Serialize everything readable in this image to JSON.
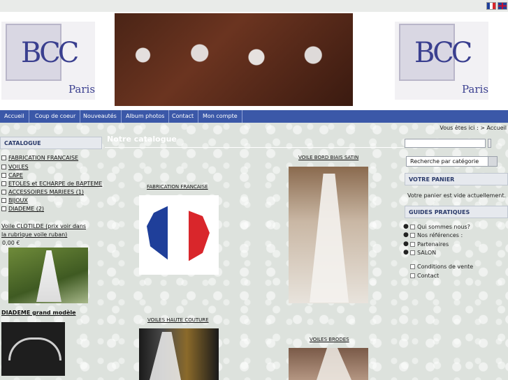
{
  "flags": [
    "french-flag-icon",
    "english-flag-icon"
  ],
  "logo": {
    "letters": "BCC",
    "city": "Paris"
  },
  "nav": [
    "Accueil",
    "Coup de coeur",
    "Nouveautés",
    "Album photos",
    "Contact",
    "Mon compte"
  ],
  "breadcrumb": "Vous êtes ici : > Accueil",
  "catalogue": {
    "title": "CATALOGUE",
    "items": [
      "FABRICATION FRANCAISE",
      "VOILES",
      "CAPE",
      "ETOLES et ECHARPE de BAPTEME",
      "ACCESSOIRES MARIEES (1)",
      "BIJOUX",
      "DIADEME (2)"
    ],
    "promo1": {
      "title": "Voile CLOTILDE (prix voir dans la rubrique voile ruban)",
      "price": "0,00 €"
    },
    "promo2": {
      "title": "DIADEME grand modèle"
    }
  },
  "main": {
    "title": "Notre catalogue",
    "products": [
      "FABRICATION FRANCAISE",
      "VOILE BORD BIAIS SATIN",
      "VOILES HAUTE COUTURE",
      "VOILES BRODES"
    ]
  },
  "search": {
    "button": "Recherche par catégorie"
  },
  "cart": {
    "title": "VOTRE PANIER",
    "text": "Votre panier est vide actuellement."
  },
  "guides": {
    "title": "GUIDES PRATIQUES",
    "items": [
      "Qui sommes nous?",
      "Nos références :",
      "Partenaires",
      "SALON",
      "Conditions de vente",
      "Contact"
    ]
  },
  "colors": {
    "nav": "#3b58a8",
    "logo_text": "#3a3f8f",
    "flag_red": "#d9262b"
  }
}
